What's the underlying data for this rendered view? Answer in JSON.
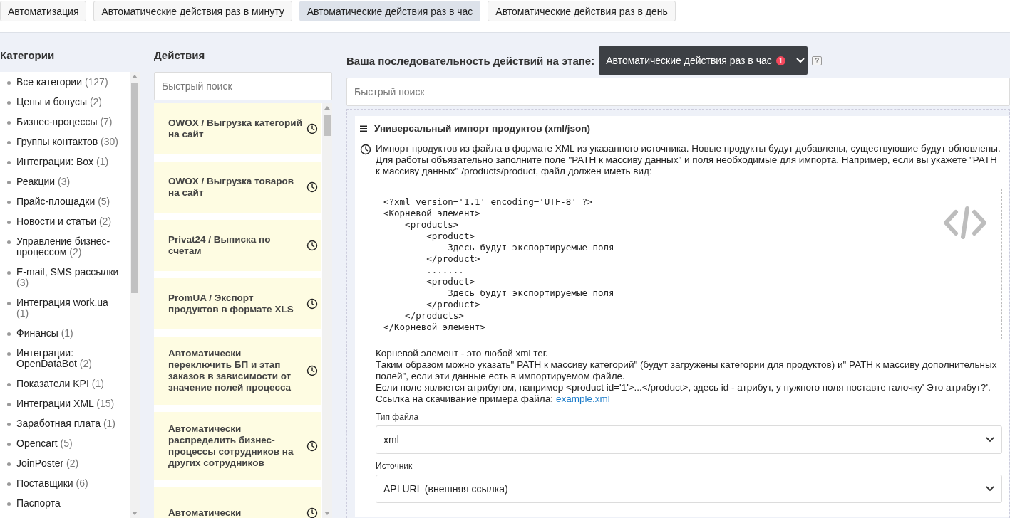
{
  "tabs": [
    {
      "label": "Автоматизация",
      "selected": false
    },
    {
      "label": "Автоматические действия раз в минуту",
      "selected": false
    },
    {
      "label": "Автоматические действия раз в час",
      "selected": true
    },
    {
      "label": "Автоматические действия раз в день",
      "selected": false
    }
  ],
  "categories": {
    "title": "Категории",
    "items": [
      {
        "name": "Все категории",
        "count": "(127)"
      },
      {
        "name": "Цены и бонусы",
        "count": "(2)"
      },
      {
        "name": "Бизнес-процессы",
        "count": "(7)"
      },
      {
        "name": "Группы контактов",
        "count": "(30)"
      },
      {
        "name": "Интеграции: Box",
        "count": "(1)"
      },
      {
        "name": "Реакции",
        "count": "(3)"
      },
      {
        "name": "Прайс-площадки",
        "count": "(5)"
      },
      {
        "name": "Новости и статьи",
        "count": "(2)"
      },
      {
        "name": "Управление бизнес-процессом",
        "count": "(2)"
      },
      {
        "name": "E-mail, SMS рассылки",
        "count": "(3)"
      },
      {
        "name": "Интеграция work.ua",
        "count": "(1)"
      },
      {
        "name": "Финансы",
        "count": "(1)"
      },
      {
        "name": "Интеграции: OpenDataBot",
        "count": "(2)"
      },
      {
        "name": "Показатели KPI",
        "count": "(1)"
      },
      {
        "name": "Интеграции XML",
        "count": "(15)"
      },
      {
        "name": "Заработная плата",
        "count": "(1)"
      },
      {
        "name": "Opencart",
        "count": "(5)"
      },
      {
        "name": "JoinPoster",
        "count": "(2)"
      },
      {
        "name": "Поставщики",
        "count": "(6)"
      },
      {
        "name": "Паспорта"
      }
    ]
  },
  "actions": {
    "title": "Действия",
    "search": {
      "placeholder": "Быстрый поиск"
    },
    "items": [
      {
        "title": "OWOX / Выгрузка категорий на сайт"
      },
      {
        "title": "OWOX / Выгрузка товаров на сайт"
      },
      {
        "title": "Privat24 / Выписка по счетам"
      },
      {
        "title": "PromUA / Экспорт продуктов в формате XLS"
      },
      {
        "title": "Автоматически переключить БП и этап заказов в зависимости от значение полей процесса"
      },
      {
        "title": "Автоматически распределить бизнес-процессы сотрудников на других сотрудников"
      },
      {
        "title": "Автоматически"
      }
    ]
  },
  "sequence": {
    "title": "Ваша последовательность действий на этапе:",
    "stage": "Автоматические действия раз в час",
    "badge": "1",
    "help": "?",
    "search": {
      "placeholder": "Быстрый поиск"
    },
    "card": {
      "title": "Универсальный импорт продуктов (xml/json)",
      "description": "Импорт продуктов из файла в формате XML из указанного источника. Новые продукты будут добавлены, существующие будут обновлены. Для работы объязательно заполните поле \"PATH к массиву данных\" и поля необходимые для импорта. Например, если вы укажете \"PATH к массиву данных\" /products/product, файл должен иметь вид:",
      "code": "<?xml version='1.1' encoding='UTF-8' ?>\n<Корневой элемент>\n    <products>\n        <product>\n            Здесь будут экспортируемые поля\n        </product>\n        .......\n        <product>\n            Здесь будут экспортируемые поля\n        </product>\n    </products>\n</Корневой элемент>",
      "notes": [
        "Корневой элемент - это любой xml тег.",
        "Таким образом можно указать\" PATH к массиву категорий\" (будут загружены категории для продуктов) и\" PATH к массиву дополнительных полей\", если эти данные есть в импортируемом файле.",
        "Если поле является атрибутом, например <product id='1'>...</product>, здесь id - атрибут, у нужного поля поставте галочку' Это атрибут?'."
      ],
      "link_text": "Ссылка на скачивание примера файла:",
      "link": "example.xml",
      "fields": [
        {
          "label": "Тип файла",
          "value": "xml"
        },
        {
          "label": "Источник",
          "value": "API URL (внешняя ссылка)"
        }
      ]
    }
  }
}
